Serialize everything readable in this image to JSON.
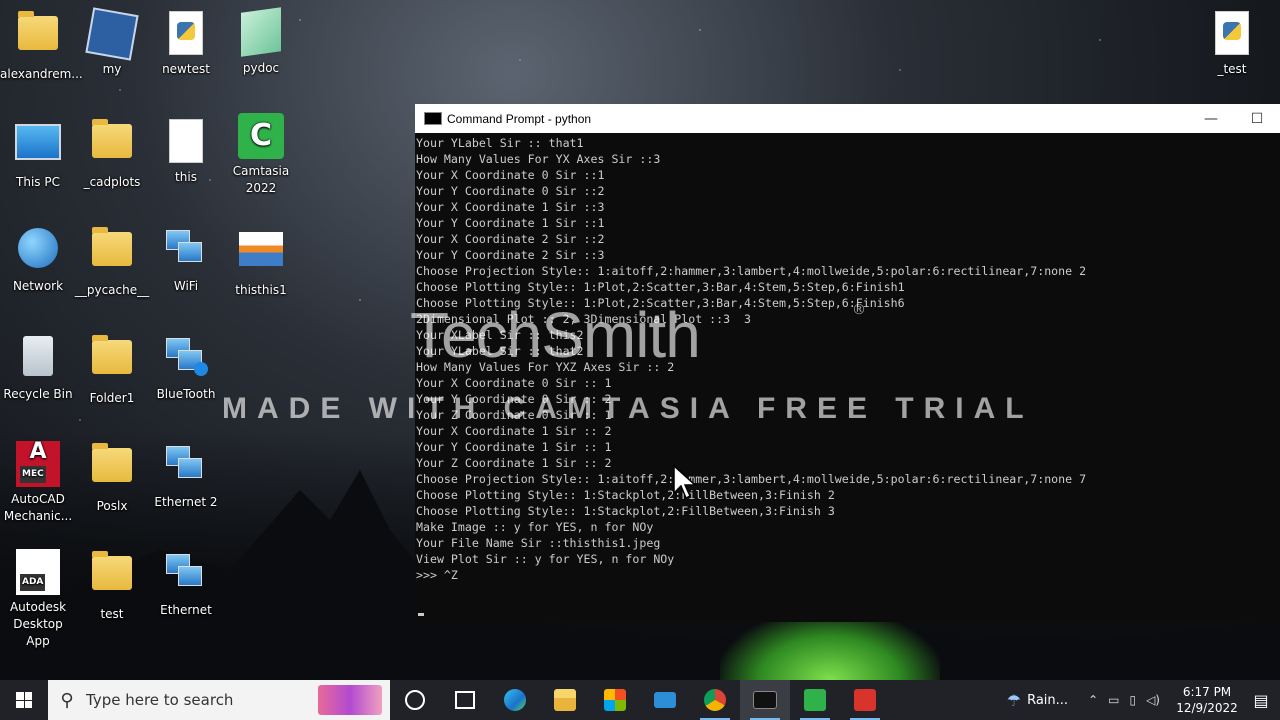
{
  "desktop": {
    "icons": [
      {
        "label": "alexandrem...",
        "type": "folder-user-icon"
      },
      {
        "label": "my",
        "type": "virtualbox-icon"
      },
      {
        "label": "newtest",
        "type": "python-file-icon"
      },
      {
        "label": "pydoc",
        "type": "notepad-icon"
      },
      {
        "label": "This PC",
        "type": "computer-icon"
      },
      {
        "label": "_cadplots",
        "type": "folder-icon"
      },
      {
        "label": "this",
        "type": "document-icon"
      },
      {
        "label": "Camtasia 2022",
        "type": "camtasia-icon"
      },
      {
        "label": "Network",
        "type": "network-globe-icon"
      },
      {
        "label": "__pycache__",
        "type": "folder-icon"
      },
      {
        "label": "WiFi",
        "type": "network-wifi-icon"
      },
      {
        "label": "thisthis1",
        "type": "image-file-icon"
      },
      {
        "label": "Recycle Bin",
        "type": "recycle-bin-icon"
      },
      {
        "label": "Folder1",
        "type": "folder-icon"
      },
      {
        "label": "BlueTooth",
        "type": "network-bluetooth-icon"
      },
      {
        "label": "AutoCAD Mechanic...",
        "type": "autocad-icon"
      },
      {
        "label": "Poslx",
        "type": "folder-icon"
      },
      {
        "label": "Ethernet 2",
        "type": "network-ethernet-icon"
      },
      {
        "label": "Autodesk Desktop App",
        "type": "autodesk-app-icon"
      },
      {
        "label": "test",
        "type": "folder-icon"
      },
      {
        "label": "Ethernet",
        "type": "network-ethernet-icon"
      },
      {
        "label": "_test",
        "type": "python-file-icon"
      }
    ],
    "autocad_tag": "MEC",
    "ada_tag": "ADA"
  },
  "cmd": {
    "title": "Command Prompt - python",
    "minimize": "—",
    "maximize": "☐",
    "lines": [
      "Your YLabel Sir :: that1",
      "How Many Values For YX Axes Sir ::3",
      "Your X Coordinate 0 Sir ::1",
      "Your Y Coordinate 0 Sir ::2",
      "Your X Coordinate 1 Sir ::3",
      "Your Y Coordinate 1 Sir ::1",
      "Your X Coordinate 2 Sir ::2",
      "Your Y Coordinate 2 Sir ::3",
      "Choose Projection Style:: 1:aitoff,2:hammer,3:lambert,4:mollweide,5:polar:6:rectilinear,7:none 2",
      "Choose Plotting Style:: 1:Plot,2:Scatter,3:Bar,4:Stem,5:Step,6:Finish1",
      "Choose Plotting Style:: 1:Plot,2:Scatter,3:Bar,4:Stem,5:Step,6:Finish6",
      "2Dimensional Plot :: 2, 3Dimensional Plot ::3  3",
      "Your XLabel Sir :: this2",
      "Your YLabel Sir :: that2",
      "How Many Values For YXZ Axes Sir :: 2",
      "Your X Coordinate 0 Sir :: 1",
      "Your Y Coordinate 0 Sir :: 2",
      "Your Z Coordinate 0 Sir :: 1",
      "Your X Coordinate 1 Sir :: 2",
      "Your Y Coordinate 1 Sir :: 1",
      "Your Z Coordinate 1 Sir :: 2",
      "Choose Projection Style:: 1:aitoff,2:hammer,3:lambert,4:mollweide,5:polar:6:rectilinear,7:none 7",
      "Choose Plotting Style:: 1:Stackplot,2:FillBetween,3:Finish 2",
      "Choose Plotting Style:: 1:Stackplot,2:FillBetween,3:Finish 3",
      "Make Image :: y for YES, n for NOy",
      "Your File Name Sir ::thisthis1.jpeg",
      "View Plot Sir :: y for YES, n for NOy",
      ">>> ^Z"
    ]
  },
  "watermark": {
    "logo": "TechSmith",
    "reg": "®",
    "text": "MADE WITH CAMTASIA FREE TRIAL"
  },
  "taskbar": {
    "search_placeholder": "Type here to search",
    "weather": "Rain...",
    "time": "6:17 PM",
    "date": "12/9/2022"
  }
}
